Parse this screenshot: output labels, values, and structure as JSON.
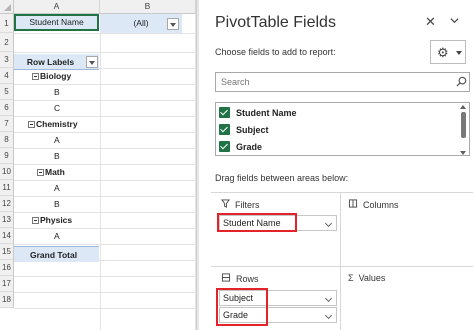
{
  "sheet": {
    "columns": [
      "A",
      "B"
    ],
    "rows": [
      "1",
      "2",
      "3",
      "4",
      "5",
      "6",
      "7",
      "8",
      "9",
      "10",
      "11",
      "12",
      "13",
      "14",
      "15",
      "16",
      "17",
      "18"
    ],
    "filter_field": "Student Name",
    "filter_value": "(All)",
    "row_labels_header": "Row Labels",
    "groups": [
      {
        "name": "Biology",
        "items": [
          "B",
          "C"
        ]
      },
      {
        "name": "Chemistry",
        "items": [
          "A",
          "B"
        ]
      },
      {
        "name": "Math",
        "items": [
          "A",
          "B"
        ]
      },
      {
        "name": "Physics",
        "items": [
          "A"
        ]
      }
    ],
    "grand_total": "Grand Total"
  },
  "panel": {
    "title": "PivotTable Fields",
    "choose_text": "Choose fields to add to report:",
    "search_placeholder": "Search",
    "fields": [
      "Student Name",
      "Subject",
      "Grade"
    ],
    "drag_text": "Drag fields between areas below:",
    "areas": {
      "filters": {
        "label": "Filters",
        "fields": [
          "Student Name"
        ]
      },
      "columns": {
        "label": "Columns",
        "fields": []
      },
      "rows": {
        "label": "Rows",
        "fields": [
          "Subject",
          "Grade"
        ]
      },
      "values": {
        "label": "Values",
        "fields": []
      }
    }
  },
  "colors": {
    "accent": "#217346",
    "highlight": "#e2232a",
    "pivot_fill": "#dde8f6"
  },
  "icons": [
    "close-icon",
    "chevron-down-icon",
    "gear-icon",
    "search-icon",
    "filter-icon",
    "columns-icon",
    "rows-icon",
    "sigma-icon",
    "minus-box-icon"
  ]
}
